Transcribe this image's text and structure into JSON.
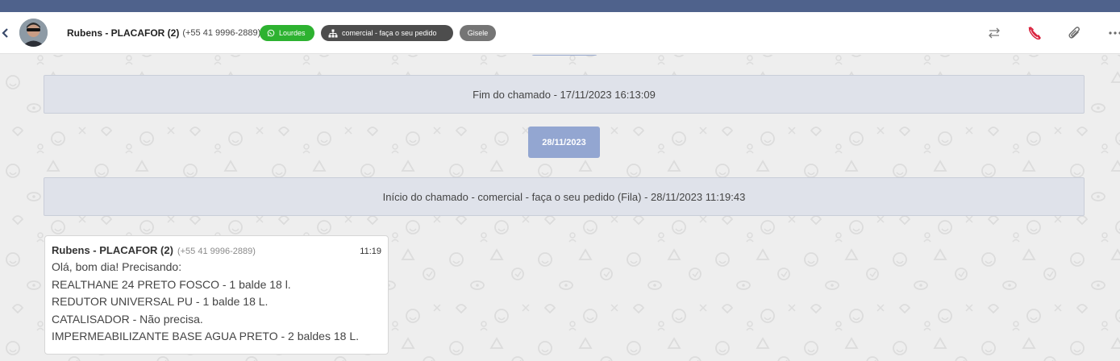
{
  "header": {
    "contact_name": "Rubens - PLACAFOR (2)",
    "contact_phone": "(+55 41 9996-2889)",
    "badges": {
      "whatsapp": {
        "label": "Lourdes",
        "icon": "whatsapp-icon",
        "color": "#2db230"
      },
      "queue": {
        "label": "comercial - faça o seu pedido",
        "icon": "sitemap-icon",
        "color": "#4d4d4d"
      },
      "agent": {
        "label": "Gisele",
        "color": "#757575"
      }
    },
    "icons": [
      "back-icon",
      "transfer-icon",
      "phone-off-icon",
      "attach-icon",
      "more-icon"
    ]
  },
  "chat": {
    "system_end": "Fim do chamado - 17/11/2023 16:13:09",
    "date_chip": "28/11/2023",
    "system_start": "Início do chamado - comercial - faça o seu pedido (Fila) - 28/11/2023 11:19:43",
    "message": {
      "sender": "Rubens - PLACAFOR (2)",
      "phone": "(+55 41 9996-2889)",
      "time": "11:19",
      "lines": [
        "Olá, bom dia! Precisando:",
        "REALTHANE 24 PRETO FOSCO - 1 balde 18 l.",
        "REDUTOR UNIVERSAL PU - 1 balde 18 L.",
        "CATALISADOR - Não precisa.",
        "IMPERMEABILIZANTE BASE AGUA PRETO - 2 baldes 18 L."
      ]
    }
  },
  "colors": {
    "topbar": "#4f628c",
    "date_chip": "#93a6d1",
    "system_bg": "#dfe2ea",
    "hangup": "#d9213d"
  }
}
